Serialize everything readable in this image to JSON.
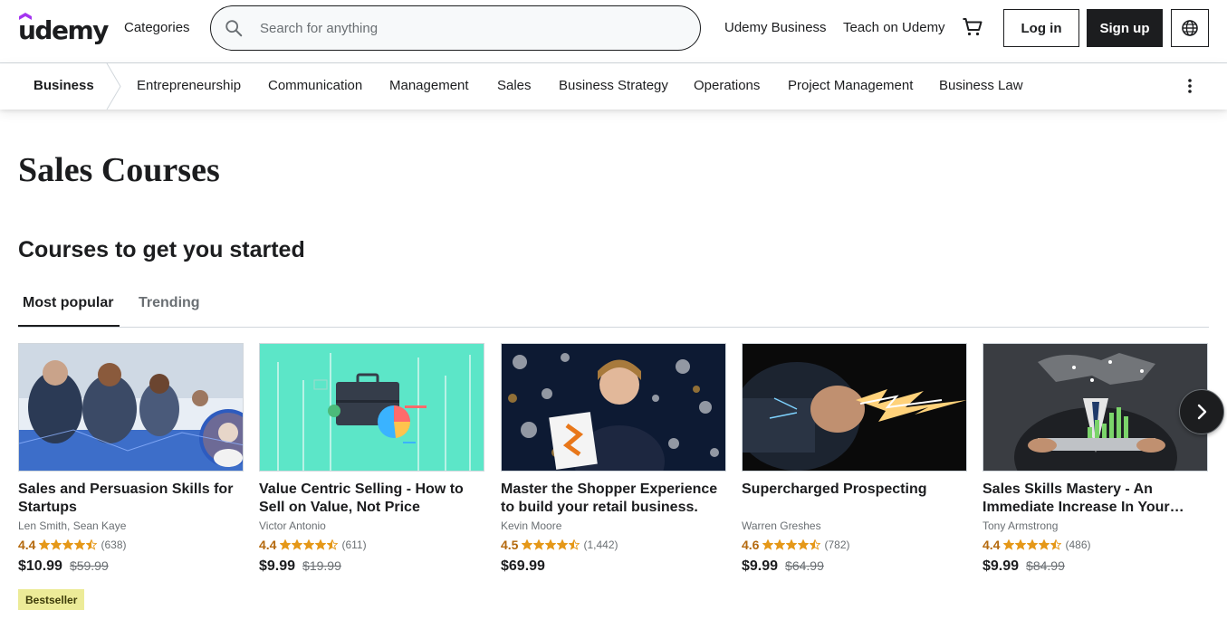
{
  "header": {
    "logo_text": "udemy",
    "categories_label": "Categories",
    "search_placeholder": "Search for anything",
    "udemy_business_label": "Udemy Business",
    "teach_label": "Teach on Udemy",
    "login_label": "Log in",
    "signup_label": "Sign up",
    "brand_color": "#a435f0"
  },
  "subnav": {
    "root": "Business",
    "items": [
      "Entrepreneurship",
      "Communication",
      "Management",
      "Sales",
      "Business Strategy",
      "Operations",
      "Project Management",
      "Business Law"
    ]
  },
  "page_title": "Sales Courses",
  "section_title": "Courses to get you started",
  "tabs": [
    {
      "label": "Most popular",
      "active": true
    },
    {
      "label": "Trending",
      "active": false
    }
  ],
  "courses": [
    {
      "title": "Sales and Persuasion Skills for Startups",
      "author": "Len Smith, Sean Kaye",
      "rating": "4.4",
      "stars": 4.5,
      "reviews": "(638)",
      "price": "$10.99",
      "original_price": "$59.99",
      "badge": "Bestseller"
    },
    {
      "title": "Value Centric Selling - How to Sell on Value, Not Price",
      "author": "Victor Antonio",
      "rating": "4.4",
      "stars": 4.5,
      "reviews": "(611)",
      "price": "$9.99",
      "original_price": "$19.99"
    },
    {
      "title": "Master the Shopper Experience to build your retail business.",
      "author": "Kevin Moore",
      "rating": "4.5",
      "stars": 4.5,
      "reviews": "(1,442)",
      "price": "$69.99",
      "original_price": ""
    },
    {
      "title": "Supercharged Prospecting",
      "author": "Warren Greshes",
      "rating": "4.6",
      "stars": 4.5,
      "reviews": "(782)",
      "price": "$9.99",
      "original_price": "$64.99"
    },
    {
      "title": "Sales Skills Mastery - An Immediate Increase In Your…",
      "author": "Tony Armstrong",
      "rating": "4.4",
      "stars": 4.5,
      "reviews": "(486)",
      "price": "$9.99",
      "original_price": "$84.99"
    }
  ],
  "icons": {
    "search": "search-icon",
    "cart": "cart-icon",
    "language": "globe-icon",
    "more": "more-vertical-icon",
    "next": "chevron-right-icon"
  },
  "colors": {
    "rating": "#b4690e",
    "star": "#e59819",
    "badge_bg": "#eceb98",
    "text": "#1c1d1f"
  }
}
